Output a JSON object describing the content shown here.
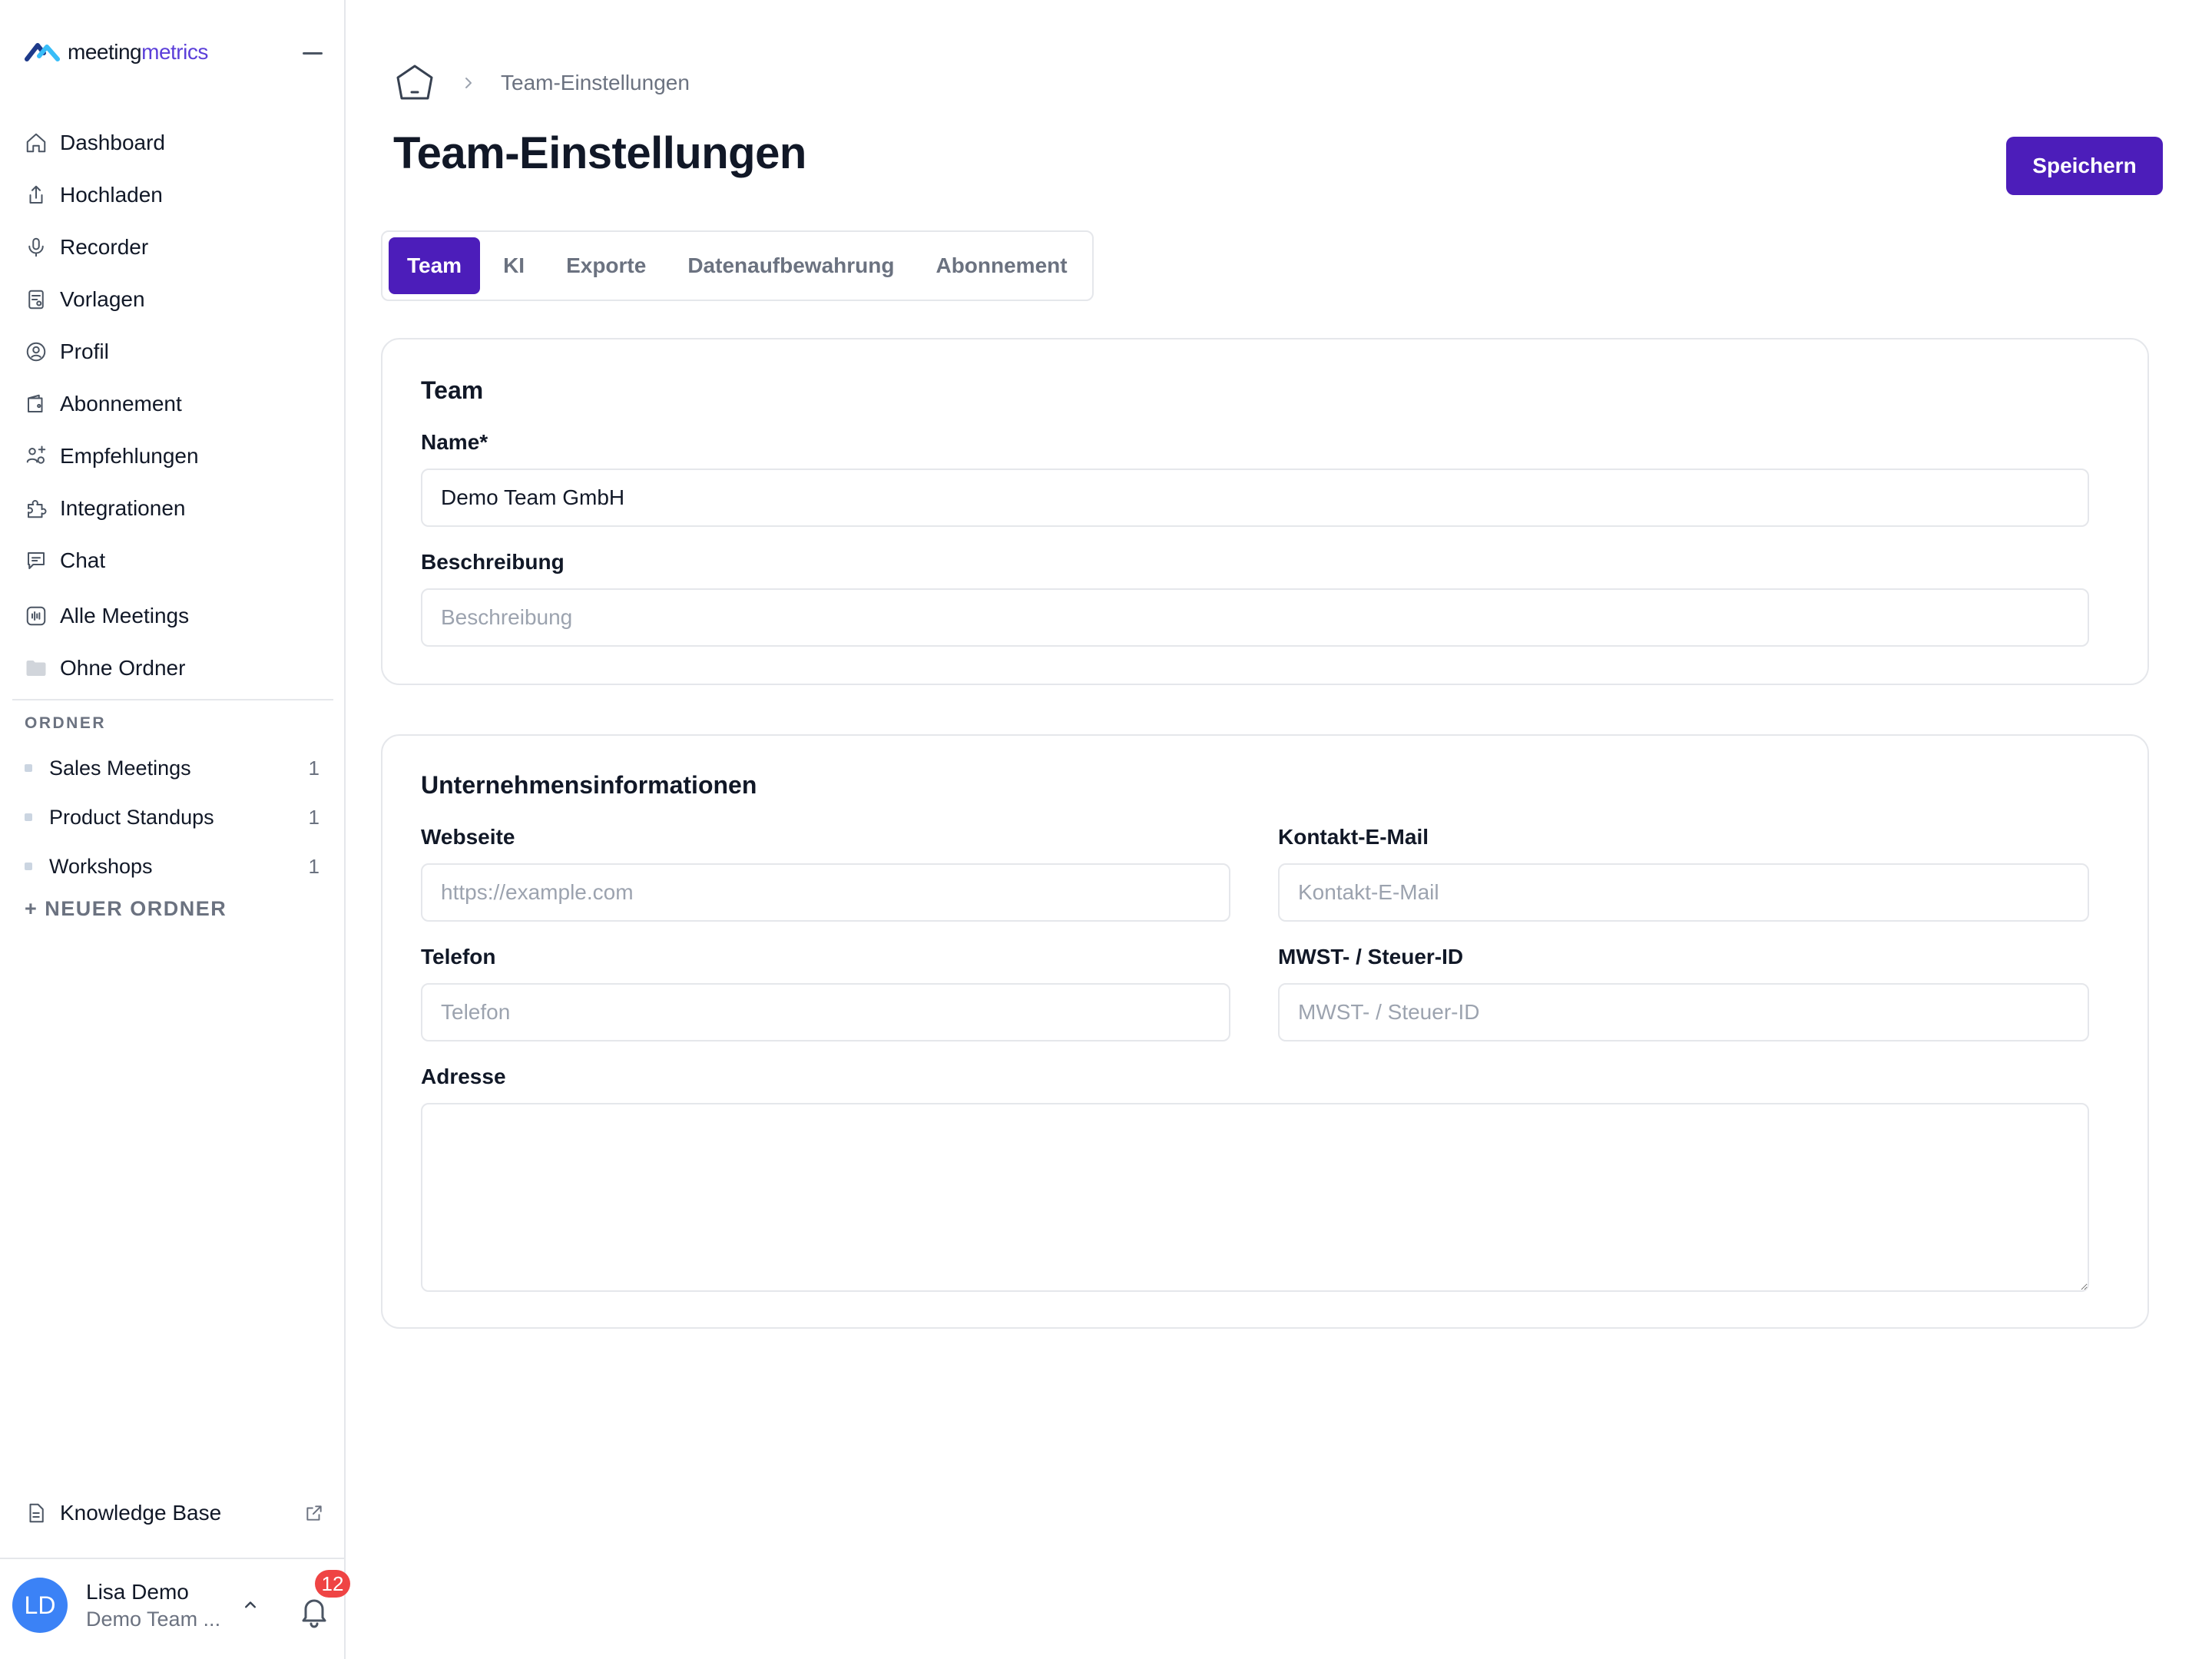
{
  "app": {
    "logo_main": "meeting",
    "logo_accent": "metrics",
    "brand_color": "#4c1dba"
  },
  "sidebar": {
    "nav": [
      {
        "label": "Dashboard",
        "icon": "home-icon"
      },
      {
        "label": "Hochladen",
        "icon": "upload-icon"
      },
      {
        "label": "Recorder",
        "icon": "microphone-icon"
      },
      {
        "label": "Vorlagen",
        "icon": "template-icon"
      },
      {
        "label": "Profil",
        "icon": "profile-icon"
      },
      {
        "label": "Abonnement",
        "icon": "wallet-icon"
      },
      {
        "label": "Empfehlungen",
        "icon": "referral-icon"
      },
      {
        "label": "Integrationen",
        "icon": "puzzle-icon"
      },
      {
        "label": "Chat",
        "icon": "chat-icon"
      },
      {
        "label": "Alle Meetings",
        "icon": "audio-wave-icon"
      },
      {
        "label": "Ohne Ordner",
        "icon": "folder-icon"
      }
    ],
    "folders_title": "ORDNER",
    "folders": [
      {
        "name": "Sales Meetings",
        "count": "1"
      },
      {
        "name": "Product Standups",
        "count": "1"
      },
      {
        "name": "Workshops",
        "count": "1"
      }
    ],
    "new_folder": "+ NEUER ORDNER",
    "knowledge_base": "Knowledge Base",
    "user": {
      "initials": "LD",
      "name": "Lisa Demo",
      "team": "Demo Team ...",
      "notifications": "12"
    }
  },
  "header": {
    "breadcrumb": "Team-Einstellungen",
    "title": "Team-Einstellungen",
    "save_label": "Speichern"
  },
  "tabs": [
    "Team",
    "KI",
    "Exporte",
    "Datenaufbewahrung",
    "Abonnement"
  ],
  "team_card": {
    "title": "Team",
    "name_label": "Name*",
    "name_value": "Demo Team GmbH",
    "description_label": "Beschreibung",
    "description_placeholder": "Beschreibung"
  },
  "company_card": {
    "title": "Unternehmensinformationen",
    "website_label": "Webseite",
    "website_placeholder": "https://example.com",
    "email_label": "Kontakt-E-Mail",
    "email_placeholder": "Kontakt-E-Mail",
    "phone_label": "Telefon",
    "phone_placeholder": "Telefon",
    "vat_label": "MWST- / Steuer-ID",
    "vat_placeholder": "MWST- / Steuer-ID",
    "address_label": "Adresse",
    "address_value": ""
  }
}
